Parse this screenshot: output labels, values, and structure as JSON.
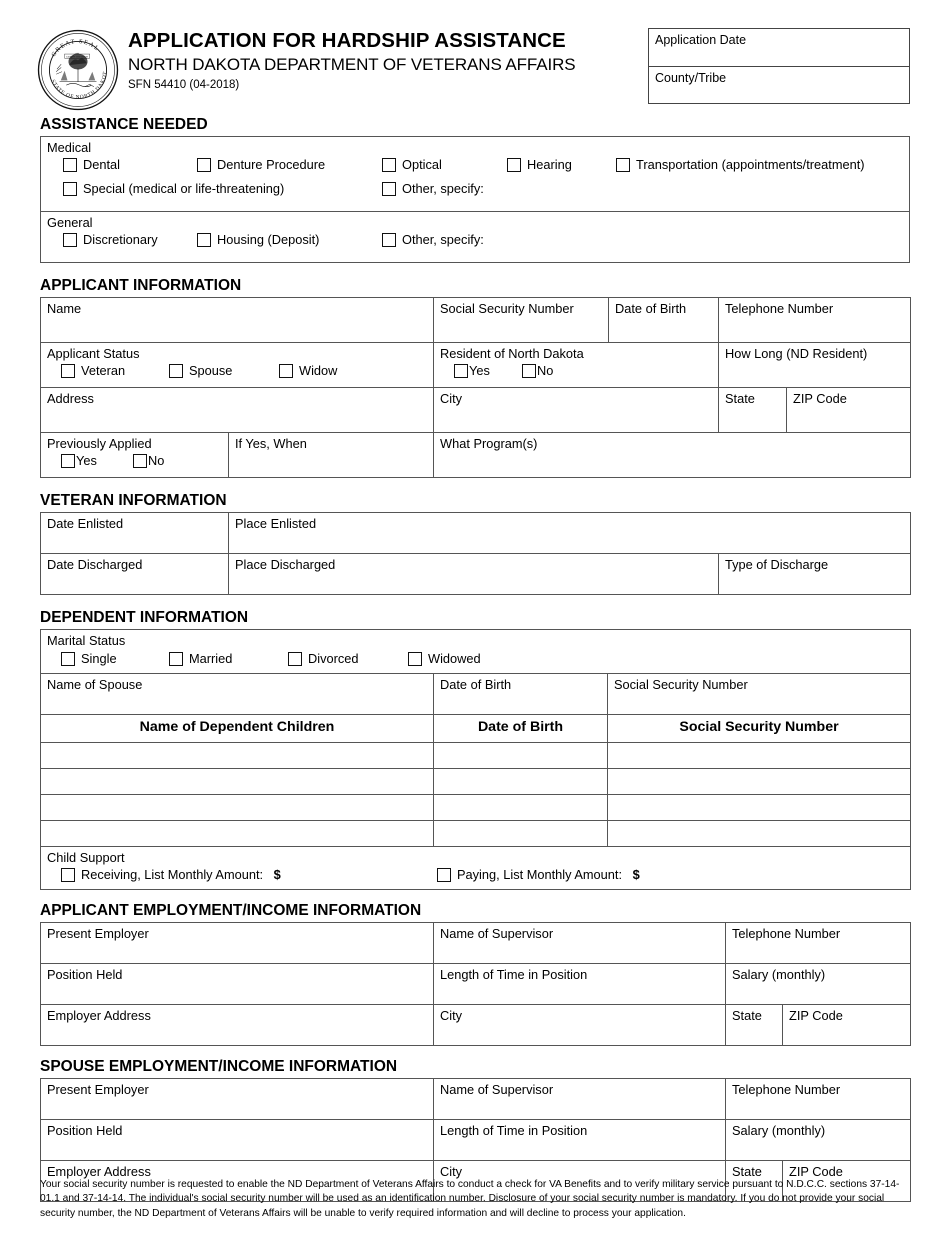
{
  "header": {
    "title": "APPLICATION FOR HARDSHIP ASSISTANCE",
    "agency": "NORTH DAKOTA DEPARTMENT OF VETERANS AFFAIRS",
    "form_number": "SFN 54410  (04-2018)",
    "seal_text_top": "GREAT SEAL",
    "seal_text_bottom": "STATE OF NORTH DAKOTA",
    "application_date_label": "Application Date",
    "county_tribe_label": "County/Tribe"
  },
  "assistance_needed": {
    "heading": "ASSISTANCE NEEDED",
    "medical": {
      "label": "Medical",
      "row1": [
        {
          "label": "Dental"
        },
        {
          "label": "Denture Procedure"
        },
        {
          "label": "Optical"
        },
        {
          "label": "Hearing"
        },
        {
          "label": "Transportation (appointments/treatment)"
        }
      ],
      "row2": [
        {
          "label": "Special (medical or life-threatening)"
        },
        {
          "label": "Other, specify:"
        }
      ]
    },
    "general": {
      "label": "General",
      "row1": [
        {
          "label": "Discretionary"
        },
        {
          "label": "Housing (Deposit)"
        },
        {
          "label": "Other, specify:"
        }
      ]
    }
  },
  "applicant_information": {
    "heading": "APPLICANT INFORMATION",
    "name_label": "Name",
    "ssn_label": "Social Security Number",
    "dob_label": "Date of Birth",
    "phone_label": "Telephone Number",
    "applicant_status_label": "Applicant Status",
    "status_options": [
      "Veteran",
      "Spouse",
      "Widow"
    ],
    "resident_label": "Resident of North Dakota",
    "resident_options": [
      "Yes",
      "No"
    ],
    "how_long_label": "How Long (ND Resident)",
    "address_label": "Address",
    "city_label": "City",
    "state_label": "State",
    "zip_label": "ZIP Code",
    "previously_applied_label": "Previously Applied",
    "previously_applied_options": [
      "Yes",
      "No"
    ],
    "if_yes_when_label": "If Yes, When",
    "what_programs_label": "What Program(s)"
  },
  "veteran_information": {
    "heading": "VETERAN INFORMATION",
    "date_enlisted_label": "Date Enlisted",
    "place_enlisted_label": "Place Enlisted",
    "date_discharged_label": "Date Discharged",
    "place_discharged_label": "Place Discharged",
    "type_of_discharge_label": "Type of Discharge"
  },
  "dependent_information": {
    "heading": "DEPENDENT INFORMATION",
    "marital_status_label": "Marital Status",
    "marital_options": [
      "Single",
      "Married",
      "Divorced",
      "Widowed"
    ],
    "spouse_name_label": "Name of Spouse",
    "spouse_dob_label": "Date of Birth",
    "spouse_ssn_label": "Social Security Number",
    "children_table_headers": [
      "Name of Dependent Children",
      "Date of Birth",
      "Social Security Number"
    ],
    "children_rows": [
      {
        "name": "",
        "dob": "",
        "ssn": ""
      },
      {
        "name": "",
        "dob": "",
        "ssn": ""
      },
      {
        "name": "",
        "dob": "",
        "ssn": ""
      },
      {
        "name": "",
        "dob": "",
        "ssn": ""
      }
    ],
    "child_support_label": "Child Support",
    "child_support_receiving": "Receiving, List Monthly Amount:",
    "child_support_paying": "Paying, List Monthly Amount:",
    "currency_symbol": "$"
  },
  "applicant_employment": {
    "heading": "APPLICANT EMPLOYMENT/INCOME INFORMATION",
    "present_employer_label": "Present Employer",
    "supervisor_label": "Name of Supervisor",
    "phone_label": "Telephone Number",
    "position_held_label": "Position Held",
    "length_of_time_label": "Length of Time in Position",
    "salary_label": "Salary (monthly)",
    "employer_address_label": "Employer Address",
    "city_label": "City",
    "state_label": "State",
    "zip_label": "ZIP Code"
  },
  "spouse_employment": {
    "heading": "SPOUSE EMPLOYMENT/INCOME INFORMATION",
    "present_employer_label": "Present Employer",
    "supervisor_label": "Name of Supervisor",
    "phone_label": "Telephone Number",
    "position_held_label": "Position Held",
    "length_of_time_label": "Length of Time in Position",
    "salary_label": "Salary (monthly)",
    "employer_address_label": "Employer Address",
    "city_label": "City",
    "state_label": "State",
    "zip_label": "ZIP Code"
  },
  "footer": {
    "disclaimer": "Your social security number is requested to enable the ND Department of Veterans Affairs to conduct a check for VA Benefits and to verify military service pursuant to N.D.C.C. sections 37-14-01.1 and 37-14-14. The individual's social security number will be used as an identification number. Disclosure of your social security number is mandatory. If you do not provide your social security number, the ND Department of Veterans Affairs will be unable to verify required information and will decline to process your application."
  },
  "colors": {
    "text": "#000000",
    "border": "#555555",
    "background": "#ffffff"
  }
}
